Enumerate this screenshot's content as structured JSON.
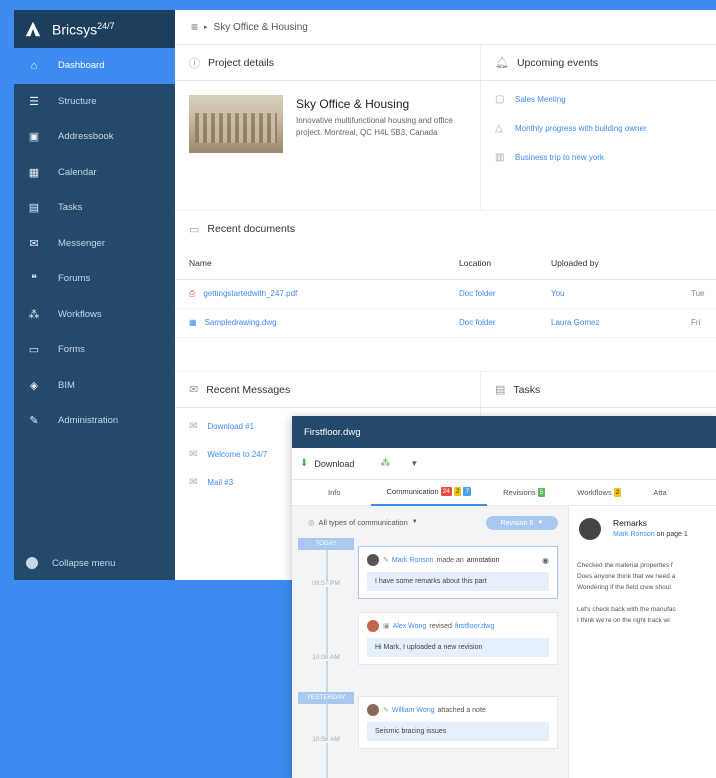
{
  "brand": {
    "name": "Bricsys",
    "suffix": "24/7"
  },
  "sidebar": {
    "items": [
      {
        "label": "Dashboard",
        "icon": "home-icon"
      },
      {
        "label": "Structure",
        "icon": "structure-icon"
      },
      {
        "label": "Addressbook",
        "icon": "addressbook-icon"
      },
      {
        "label": "Calendar",
        "icon": "calendar-icon"
      },
      {
        "label": "Tasks",
        "icon": "tasks-icon"
      },
      {
        "label": "Messenger",
        "icon": "envelope-icon"
      },
      {
        "label": "Forums",
        "icon": "quote-icon"
      },
      {
        "label": "Workflows",
        "icon": "workflow-icon"
      },
      {
        "label": "Forms",
        "icon": "forms-icon"
      },
      {
        "label": "BIM",
        "icon": "cube-icon"
      },
      {
        "label": "Administration",
        "icon": "wrench-icon"
      }
    ],
    "collapse_label": "Collapse menu"
  },
  "breadcrumb": "Sky Office & Housing",
  "project": {
    "panel_title": "Project details",
    "title": "Sky Office & Housing",
    "description": "Innovative multifunctional housing and office project. Montreal, QC H4L 5B3, Canada"
  },
  "events": {
    "panel_title": "Upcoming events",
    "items": [
      "Sales Meeting",
      "Monthly progress with building owner",
      "Business trip to new york"
    ]
  },
  "documents": {
    "panel_title": "Recent documents",
    "headers": {
      "name": "Name",
      "location": "Location",
      "uploaded_by": "Uploaded by"
    },
    "rows": [
      {
        "name": "gettingstartedwith_247.pdf",
        "location": "Doc folder",
        "uploaded_by": "You",
        "extra": "Tue"
      },
      {
        "name": "Sampledrawing.dwg",
        "location": "Doc folder",
        "uploaded_by": "Laura Gomez",
        "extra": "Fri"
      }
    ]
  },
  "messages": {
    "panel_title": "Recent Messages",
    "items": [
      "Download #1",
      "Welcome to 24/7",
      "Mail #3"
    ]
  },
  "tasks": {
    "panel_title": "Tasks"
  },
  "viewer": {
    "title": "Firstfloor.dwg",
    "download_label": "Download",
    "tabs": {
      "info": "Info",
      "communication": "Communication",
      "comm_badges": [
        "24",
        "2",
        "7"
      ],
      "revisions": "Revisions",
      "rev_badge": "5",
      "workflows": "Workflows",
      "wf_badge": "2",
      "attachments": "Atta"
    },
    "filter": "All types of communication",
    "revision_pill": "Revision 6",
    "timeline": {
      "today": "TODAY",
      "yesterday": "YESTERDAY",
      "t1": "09:57 PM",
      "t2": "10:08 AM",
      "t3": "10:58 AM"
    },
    "cards": [
      {
        "name": "Mark Ronson",
        "action": "made an",
        "link": "annotation",
        "body": "I have some remarks about this part"
      },
      {
        "name": "Alex Wong",
        "action": "revised",
        "link": "firstfloor.dwg",
        "body": "Hi Mark, I uploaded a new revision"
      },
      {
        "name": "William Wong",
        "action": "attached a note",
        "link": "",
        "body": "Seismic bracing issues"
      }
    ],
    "remark": {
      "title": "Remarks",
      "author": "Mark Ronson",
      "page": "on page 1",
      "lines": [
        "Checked the material properties f",
        "Does anyone think that we need a",
        "Wondering if the field crew shoul",
        "",
        "Let's check back with the manufac",
        "I think we're on the right track wi"
      ]
    }
  },
  "colors": {
    "accent": "#3d8bf0",
    "sidebar": "#23496b"
  }
}
